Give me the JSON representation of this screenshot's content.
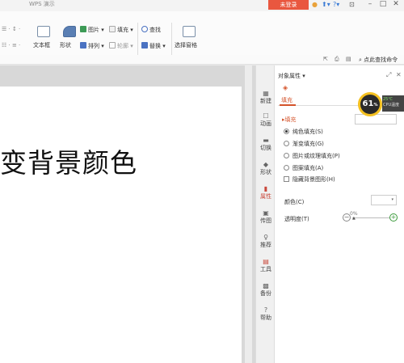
{
  "titlebar": {
    "app_title": "WPS 演示",
    "login": "未登录"
  },
  "ribbon": {
    "textbox": "文本框",
    "shape": "形状",
    "picture": "图片",
    "arrange": "排列",
    "fill": "填充",
    "outline": "轮廓",
    "find": "查找",
    "replace": "替换",
    "select_pane": "选择窗格",
    "search_command": "点此查找命令"
  },
  "slide": {
    "text": "变背景颜色"
  },
  "iconbar": {
    "items": [
      "新建",
      "动画",
      "切换",
      "形状",
      "属性",
      "传图",
      "推荐",
      "工具",
      "备份",
      "帮助"
    ]
  },
  "panel": {
    "title": "对象属性 ▾",
    "tab_fill": "填充",
    "section_fill": "▸填充",
    "options": [
      "纯色填充(S)",
      "渐变填充(G)",
      "图片或纹理填充(P)",
      "图案填充(A)"
    ],
    "hide_bg": "隐藏背景图形(H)",
    "color_label": "颜色(C)",
    "transparency_label": "透明度(T)",
    "transparency_value": "0%"
  },
  "cpu": {
    "percent": "61",
    "unit": "%",
    "temp": "25℃",
    "label": "CPU温度"
  }
}
